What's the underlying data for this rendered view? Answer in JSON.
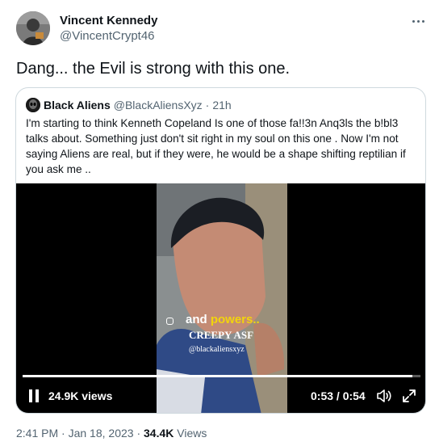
{
  "tweet": {
    "author_name": "Vincent Kennedy",
    "author_handle": "@VincentCrypt46",
    "text": "Dang... the Evil is strong with this one.",
    "more_icon": "more-horizontal-icon"
  },
  "quoted": {
    "author_name": "Black Aliens",
    "author_handle": "@BlackAliensXyz",
    "separator": "·",
    "time": "21h",
    "text": "I'm starting to think Kenneth Copeland Is one of those fa!!3n Anq3ls the b!bl3 talks about. Something just don't sit right in my soul on this one . Now I'm not saying Aliens are real, but if they were, he would be a shape shifting reptilian if you ask me .."
  },
  "video": {
    "caption_word1": "and",
    "caption_word2": "powers..",
    "caption_line2": "CREEPY ASF",
    "caption_line3": "@blackaliensxyz",
    "views": "24.9K views",
    "timecode": "0:53 / 0:54",
    "progress": 0.98,
    "pause_icon": "pause-icon",
    "volume_icon": "volume-icon",
    "fullscreen_icon": "fullscreen-icon"
  },
  "footer": {
    "time": "2:41 PM",
    "separator": "·",
    "date": "Jan 18, 2023",
    "views_count": "34.4K",
    "views_label": "Views"
  }
}
